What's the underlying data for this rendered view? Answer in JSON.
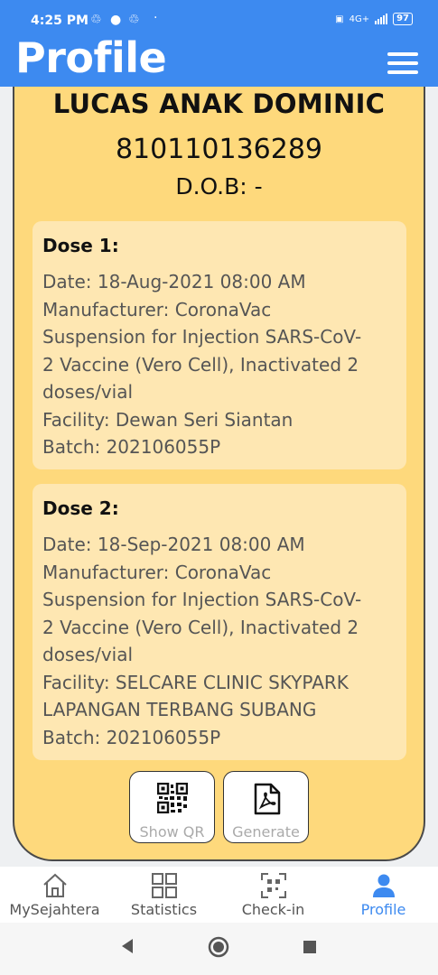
{
  "status": {
    "time": "4:25 PM",
    "battery": "97",
    "net": "4G+"
  },
  "header": {
    "title": "Profile"
  },
  "profile": {
    "name": "LUCAS ANAK DOMINIC",
    "id_number": "810110136289",
    "dob": "D.O.B: -"
  },
  "doses": [
    {
      "title": "Dose 1:",
      "date": "Date: 18-Aug-2021 08:00 AM",
      "manufacturer_lines": [
        "Manufacturer: CoronaVac",
        "Suspension for Injection SARS-CoV-",
        "2 Vaccine (Vero Cell), Inactivated 2",
        "doses/vial"
      ],
      "facility_lines": [
        "Facility: Dewan Seri Siantan"
      ],
      "batch": "Batch: 202106055P"
    },
    {
      "title": "Dose 2:",
      "date": "Date: 18-Sep-2021 08:00 AM",
      "manufacturer_lines": [
        "Manufacturer: CoronaVac",
        "Suspension for Injection SARS-CoV-",
        "2 Vaccine (Vero Cell), Inactivated 2",
        "doses/vial"
      ],
      "facility_lines": [
        "Facility: SELCARE CLINIC SKYPARK",
        "LAPANGAN TERBANG SUBANG"
      ],
      "batch": "Batch: 202106055P"
    }
  ],
  "actions": {
    "show_qr": "Show QR",
    "generate": "Generate"
  },
  "nav": {
    "home": "MySejahtera",
    "statistics": "Statistics",
    "checkin": "Check-in",
    "profile": "Profile"
  },
  "colors": {
    "header": "#3d8af0",
    "card": "#fed97c",
    "dose_bg": "#fee7b2",
    "active_nav": "#3d8af0"
  },
  "icons": [
    "sync-icon",
    "menu-icon",
    "qr-code-icon",
    "pdf-icon",
    "home-icon",
    "statistics-icon",
    "checkin-icon",
    "profile-icon",
    "back-icon",
    "home-circle-icon",
    "recent-apps-icon"
  ]
}
